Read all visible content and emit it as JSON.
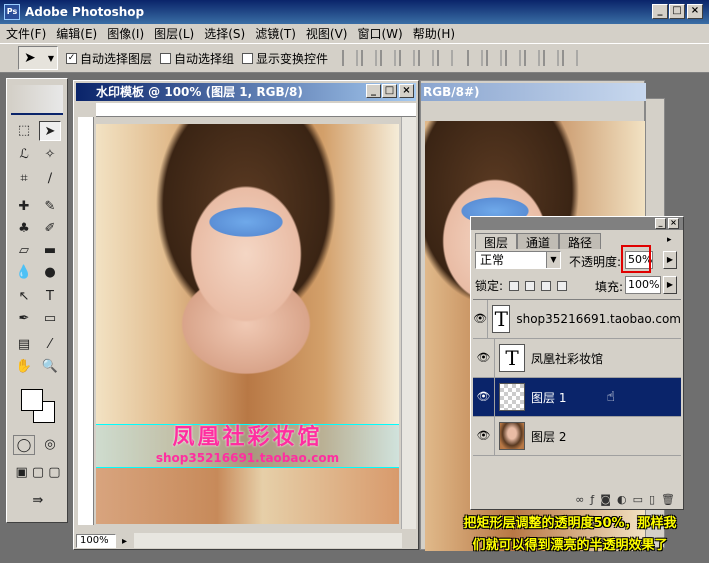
{
  "app": {
    "title": "Adobe Photoshop"
  },
  "menu": [
    "文件(F)",
    "编辑(E)",
    "图像(I)",
    "图层(L)",
    "选择(S)",
    "滤镜(T)",
    "视图(V)",
    "窗口(W)",
    "帮助(H)"
  ],
  "options": {
    "auto_select_layer": "自动选择图层",
    "auto_select_group": "自动选择组",
    "show_transform": "显示变换控件"
  },
  "document": {
    "title": "水印模板 @ 100% (图层 1, RGB/8)",
    "zoom": "100%",
    "watermark_title": "凤凰社彩妆馆",
    "watermark_sub": "shop35216691.taobao.com"
  },
  "bg_document": {
    "title": "RGB/8#)"
  },
  "layers_panel": {
    "tabs": [
      "图层",
      "通道",
      "路径"
    ],
    "blend_mode": "正常",
    "opacity_label": "不透明度:",
    "opacity": "50%",
    "lock_label": "锁定:",
    "fill_label": "填充:",
    "fill": "100%",
    "layers": [
      {
        "name": "shop35216691.taobao.com",
        "type": "text",
        "selected": false
      },
      {
        "name": "凤凰社彩妆馆",
        "type": "text",
        "selected": false
      },
      {
        "name": "图层 1",
        "type": "pixel",
        "selected": true
      },
      {
        "name": "图层 2",
        "type": "photo",
        "selected": false
      }
    ]
  },
  "caption": {
    "line1": "把矩形层调整的透明度50%，那样我",
    "line2": "们就可以得到漂亮的半透明效果了"
  },
  "colors": {
    "selection": "#0a246a",
    "watermark": "#ff2ea0",
    "highlight_box": "#e00000",
    "caption": "#ffff00"
  }
}
